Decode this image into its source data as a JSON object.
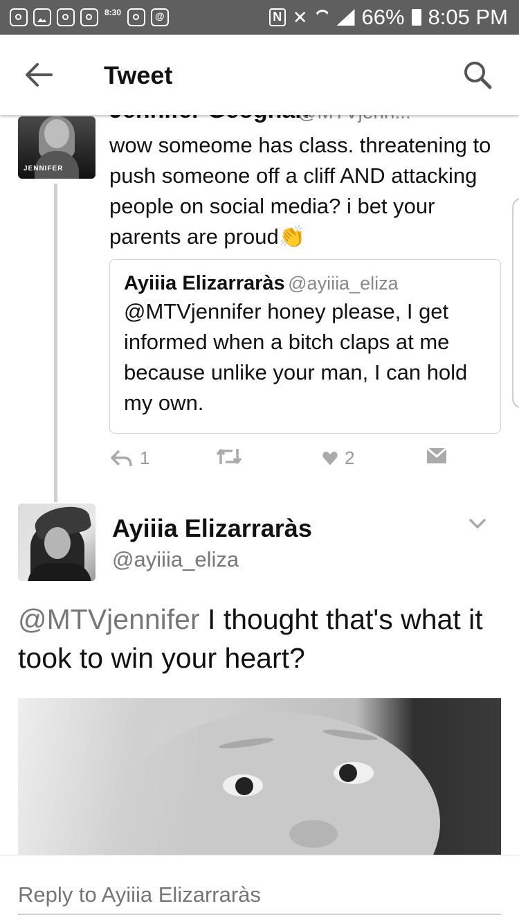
{
  "status_bar": {
    "battery": "66%",
    "time": "8:05 PM",
    "notification_icons": [
      "instagram-icon",
      "gallery-icon",
      "instagram-icon",
      "instagram-icon",
      "clock-icon",
      "instagram-icon",
      "message-icon"
    ],
    "system_icons": [
      "nfc-icon",
      "mute-icon",
      "wifi-icon",
      "signal-icon",
      "battery-icon"
    ],
    "nfc_label": "N",
    "clock_label": "8:30"
  },
  "header": {
    "title": "Tweet",
    "back_icon": "arrow-left-icon",
    "search_icon": "search-icon"
  },
  "reply_tweet": {
    "author_name_cutoff": "Jennifer Geoghan",
    "author_handle_cutoff": "@MTVjenn...",
    "avatar_label": "JENNIFER",
    "text": "wow someome has class. threatening to push someone off a cliff AND attacking people on social media? i bet your parents are proud",
    "emoji": "👏",
    "quoted": {
      "name": "Ayiiia Elizarraràs",
      "handle": "@ayiiia_eliza",
      "text": "@MTVjennifer honey please, I get informed when a bitch claps at me because unlike your man, I can hold my own."
    },
    "actions": {
      "reply_count": "1",
      "like_count": "2"
    }
  },
  "main_tweet": {
    "name": "Ayiiia Elizarraràs",
    "handle": "@ayiiia_eliza",
    "mention": "@MTVjennifer",
    "text": " I thought that's what it took to win your heart?"
  },
  "reply_bar": {
    "placeholder": "Reply to Ayiiia Elizarraràs"
  },
  "colors": {
    "status_bar": "#5f5f5f",
    "text": "#111111",
    "muted": "#888888"
  }
}
